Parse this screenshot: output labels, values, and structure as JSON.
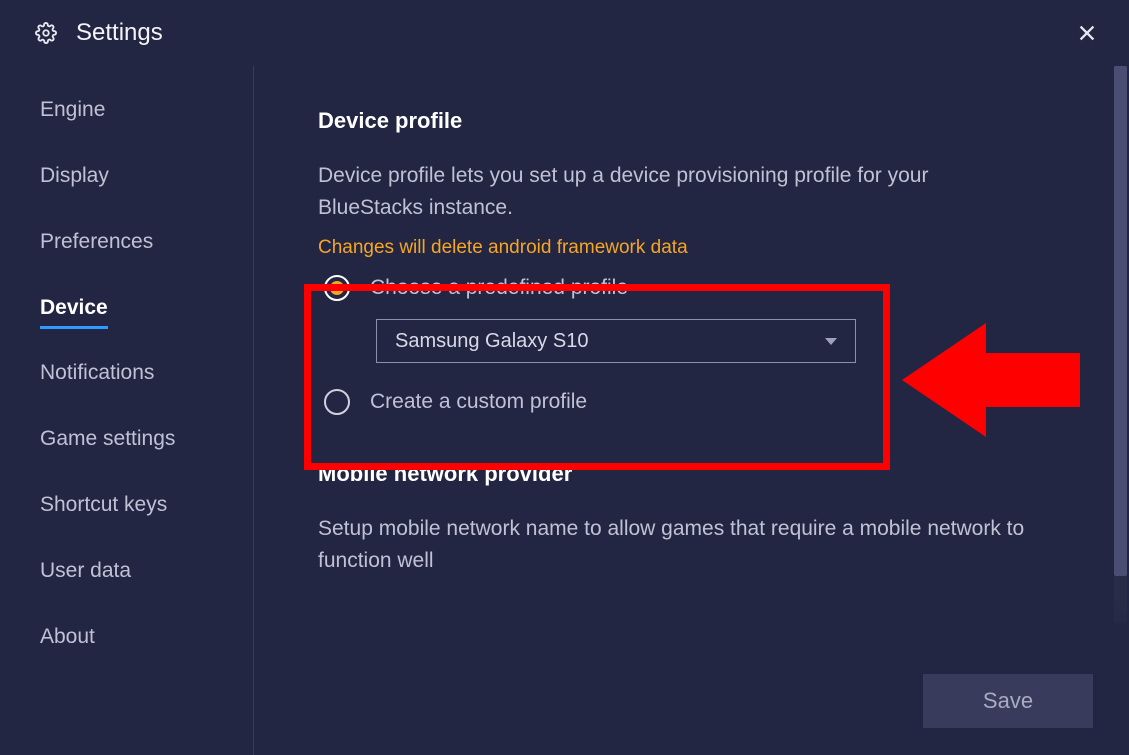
{
  "header": {
    "title": "Settings"
  },
  "sidebar": {
    "items": [
      {
        "label": "Engine",
        "name": "sidebar-item-engine",
        "selected": false
      },
      {
        "label": "Display",
        "name": "sidebar-item-display",
        "selected": false
      },
      {
        "label": "Preferences",
        "name": "sidebar-item-preferences",
        "selected": false
      },
      {
        "label": "Device",
        "name": "sidebar-item-device",
        "selected": true
      },
      {
        "label": "Notifications",
        "name": "sidebar-item-notifications",
        "selected": false
      },
      {
        "label": "Game settings",
        "name": "sidebar-item-game-settings",
        "selected": false
      },
      {
        "label": "Shortcut keys",
        "name": "sidebar-item-shortcut-keys",
        "selected": false
      },
      {
        "label": "User data",
        "name": "sidebar-item-user-data",
        "selected": false
      },
      {
        "label": "About",
        "name": "sidebar-item-about",
        "selected": false
      }
    ]
  },
  "device_profile": {
    "title": "Device profile",
    "description": "Device profile lets you set up a device provisioning profile for your BlueStacks instance.",
    "warning": "Changes will delete android framework data",
    "radio_predefined": "Choose a predefined profile",
    "radio_custom": "Create a custom profile",
    "selected_value": "Samsung Galaxy S10"
  },
  "network_provider": {
    "title": "Mobile network provider",
    "description": "Setup mobile network name to allow games that require a mobile network to function well"
  },
  "footer": {
    "save_label": "Save"
  },
  "colors": {
    "bg": "#232642",
    "accent": "#2f9bff",
    "warning": "#f5a623",
    "annotation": "#ff0000"
  }
}
